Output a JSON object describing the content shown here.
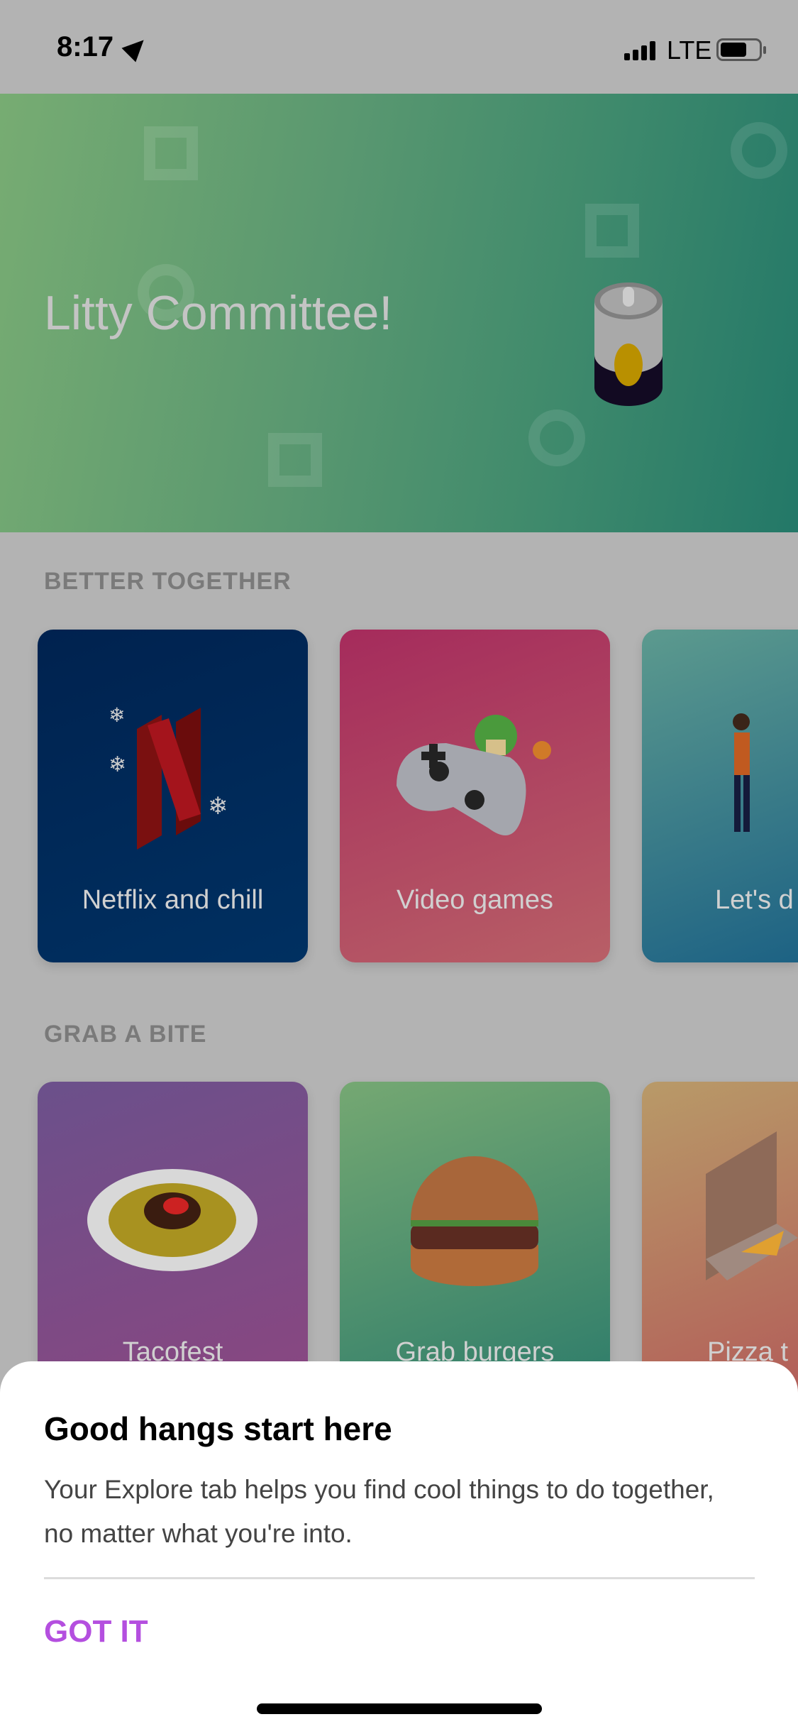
{
  "status_bar": {
    "time": "8:17",
    "network": "LTE",
    "icons": [
      "location-arrow-icon",
      "signal-icon",
      "battery-icon"
    ]
  },
  "hero": {
    "title": "Litty Committee!",
    "colors": [
      "#77ac72",
      "#237868"
    ],
    "illustration": "soda-can-icon"
  },
  "sections": [
    {
      "title": "BETTER TOGETHER",
      "cards": [
        {
          "label": "Netflix and chill",
          "colors": [
            "#00224f",
            "#003061"
          ]
        },
        {
          "label": "Video games",
          "colors": [
            "#a52b5c",
            "#b85f66"
          ]
        },
        {
          "label": "Let's d",
          "colors": [
            "#5c9a8e",
            "#1d6284"
          ]
        }
      ]
    },
    {
      "title": "GRAB A BITE",
      "cards": [
        {
          "label": "Tacofest",
          "colors": [
            "#6b508b",
            "#8b4680"
          ]
        },
        {
          "label": "Grab burgers",
          "colors": [
            "#75a872",
            "#2a7a6a"
          ]
        },
        {
          "label": "Pizza t",
          "colors": [
            "#b89a68",
            "#b25a58"
          ]
        }
      ]
    }
  ],
  "sheet": {
    "title": "Good hangs start here",
    "body": "Your Explore tab helps you find cool things to do together, no matter what you're into.",
    "button": "GOT IT",
    "accent": "#b44fdf"
  }
}
